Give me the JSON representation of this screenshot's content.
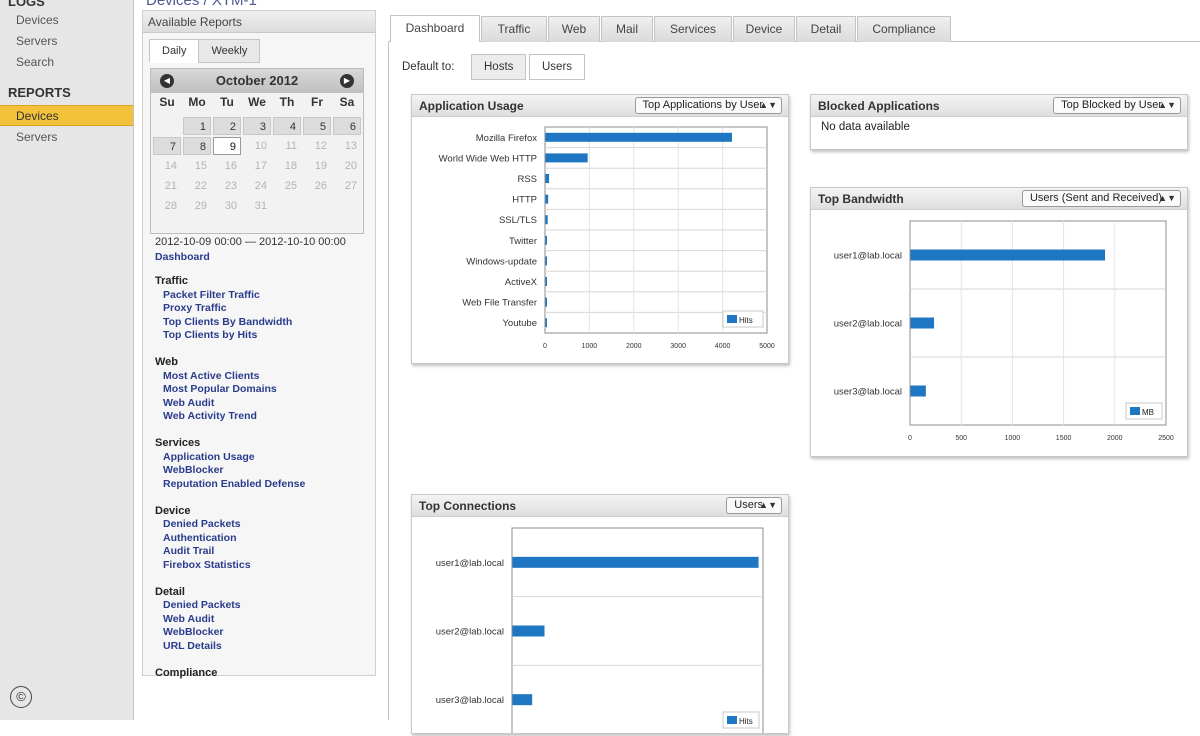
{
  "left_nav": {
    "logs_heading": "LOGS",
    "logs_items": [
      "Devices",
      "Servers",
      "Search"
    ],
    "reports_heading": "REPORTS",
    "reports_items": [
      "Devices",
      "Servers"
    ],
    "active_item": "Devices",
    "copyright_symbol": "©"
  },
  "page_title": "Devices / XTM-1",
  "reports_panel": {
    "title": "Available Reports",
    "tabs": [
      "Daily",
      "Weekly"
    ],
    "active_tab": "Daily",
    "calendar": {
      "month": "October 2012",
      "prev_icon": "◀",
      "next_icon": "▶",
      "weekdays": [
        "Su",
        "Mo",
        "Tu",
        "We",
        "Th",
        "Fr",
        "Sa"
      ],
      "rows": [
        [
          "",
          "1",
          "2",
          "3",
          "4",
          "5",
          "6"
        ],
        [
          "7",
          "8",
          "9",
          "10",
          "11",
          "12",
          "13"
        ],
        [
          "14",
          "15",
          "16",
          "17",
          "18",
          "19",
          "20"
        ],
        [
          "21",
          "22",
          "23",
          "24",
          "25",
          "26",
          "27"
        ],
        [
          "28",
          "29",
          "30",
          "31",
          "",
          "",
          ""
        ]
      ],
      "selected": "9"
    },
    "range": "2012-10-09 00:00 — 2012-10-10 00:00",
    "top_link": "Dashboard",
    "groups": [
      {
        "heading": "Traffic",
        "links": [
          "Packet Filter Traffic",
          "Proxy Traffic",
          "Top Clients By Bandwidth",
          "Top Clients by Hits"
        ]
      },
      {
        "heading": "Web",
        "links": [
          "Most Active Clients",
          "Most Popular Domains",
          "Web Audit",
          "Web Activity Trend"
        ]
      },
      {
        "heading": "Services",
        "links": [
          "Application Usage",
          "WebBlocker",
          "Reputation Enabled Defense"
        ]
      },
      {
        "heading": "Device",
        "links": [
          "Denied Packets",
          "Authentication",
          "Audit Trail",
          "Firebox Statistics"
        ]
      },
      {
        "heading": "Detail",
        "links": [
          "Denied Packets",
          "Web Audit",
          "WebBlocker",
          "URL Details"
        ]
      },
      {
        "heading": "Compliance",
        "links": []
      }
    ]
  },
  "main_tabs": [
    "Dashboard",
    "Traffic",
    "Web",
    "Mail",
    "Services",
    "Device",
    "Detail",
    "Compliance"
  ],
  "active_main_tab": "Dashboard",
  "default_to": {
    "label": "Default to:",
    "options": [
      "Hosts",
      "Users"
    ],
    "selected": "Users"
  },
  "widgets": {
    "app_usage": {
      "title": "Application Usage",
      "select": "Top Applications by User"
    },
    "blocked": {
      "title": "Blocked Applications",
      "select": "Top Blocked by User",
      "message": "No data available"
    },
    "bandwidth": {
      "title": "Top Bandwidth",
      "select": "Users (Sent and Received)"
    },
    "connections": {
      "title": "Top Connections",
      "select": "Users"
    }
  },
  "chart_data": [
    {
      "type": "bar",
      "orientation": "horizontal",
      "categories": [
        "Mozilla Firefox",
        "World Wide Web HTTP",
        "RSS",
        "HTTP",
        "SSL/TLS",
        "Twitter",
        "Windows-update",
        "ActiveX",
        "Web File Transfer",
        "Youtube"
      ],
      "series": [
        {
          "name": "Hits",
          "values": [
            4200,
            950,
            80,
            60,
            50,
            20,
            15,
            10,
            8,
            5
          ]
        }
      ],
      "xlim": [
        0,
        5000
      ],
      "xticks": [
        "0",
        "1000",
        "2000",
        "3000",
        "4000",
        "5000"
      ],
      "grid": true,
      "legend": "bottom-right",
      "color": "#1f77c4"
    },
    {
      "type": "bar",
      "orientation": "horizontal",
      "categories": [
        "user1@lab.local",
        "user2@lab.local",
        "user3@lab.local"
      ],
      "series": [
        {
          "name": "MB",
          "values": [
            1900,
            230,
            150
          ]
        }
      ],
      "xlim": [
        0,
        2500
      ],
      "xticks": [
        "0",
        "500",
        "1000",
        "1500",
        "2000",
        "2500"
      ],
      "grid": true,
      "legend": "bottom-right",
      "color": "#1f77c4"
    },
    {
      "type": "bar",
      "orientation": "horizontal",
      "categories": [
        "user1@lab.local",
        "user2@lab.local",
        "user3@lab.local"
      ],
      "series": [
        {
          "name": "Hits",
          "values": [
            100,
            13,
            8
          ]
        }
      ],
      "xlim": [
        0,
        102
      ],
      "grid": true,
      "legend": "bottom-right",
      "color": "#1f77c4"
    }
  ]
}
